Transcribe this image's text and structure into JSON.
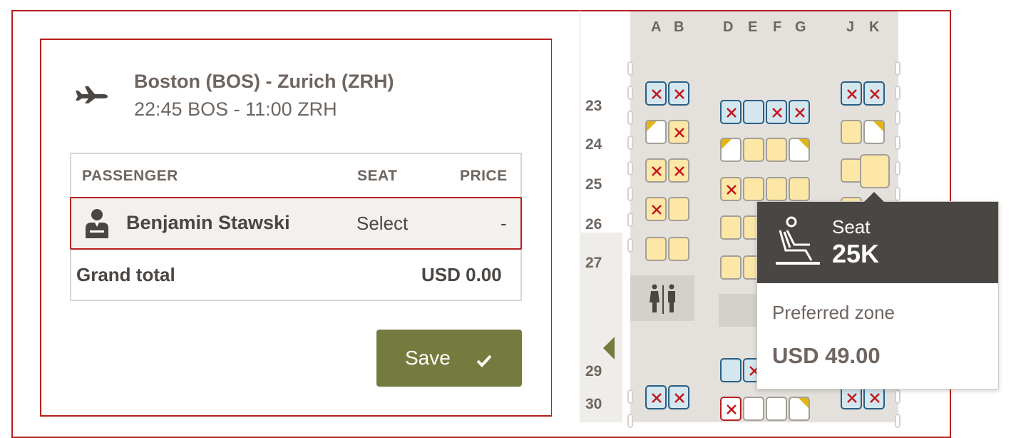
{
  "flight": {
    "route": "Boston (BOS) - Zurich (ZRH)",
    "times": "22:45 BOS - 11:00 ZRH"
  },
  "passenger_table": {
    "headers": {
      "passenger": "PASSENGER",
      "seat": "SEAT",
      "price": "PRICE"
    },
    "rows": [
      {
        "name": "Benjamin Stawski",
        "seat": "Select",
        "price": "-"
      }
    ],
    "grand_total_label": "Grand total",
    "grand_total_value": "USD 0.00"
  },
  "actions": {
    "save_label": "Save"
  },
  "seatmap": {
    "columns": [
      "A",
      "B",
      "D",
      "E",
      "F",
      "G",
      "J",
      "K"
    ],
    "rows": [
      "23",
      "24",
      "25",
      "26",
      "27",
      "29",
      "30"
    ]
  },
  "tooltip": {
    "seat_label": "Seat",
    "seat_number": "25K",
    "zone": "Preferred zone",
    "price": "USD 49.00"
  },
  "colors": {
    "brand_red": "#b5201e",
    "save_green": "#757b3e",
    "tooltip_dark": "#4a4643",
    "seat_available": "#fde7a7",
    "seat_occupied": "#d4e6ee"
  },
  "icons": {
    "flight": "airplane-icon",
    "passenger": "person-icon",
    "save": "checkmark-icon",
    "seat": "reclining-seat-icon",
    "lavatory": "lavatory-icon"
  }
}
